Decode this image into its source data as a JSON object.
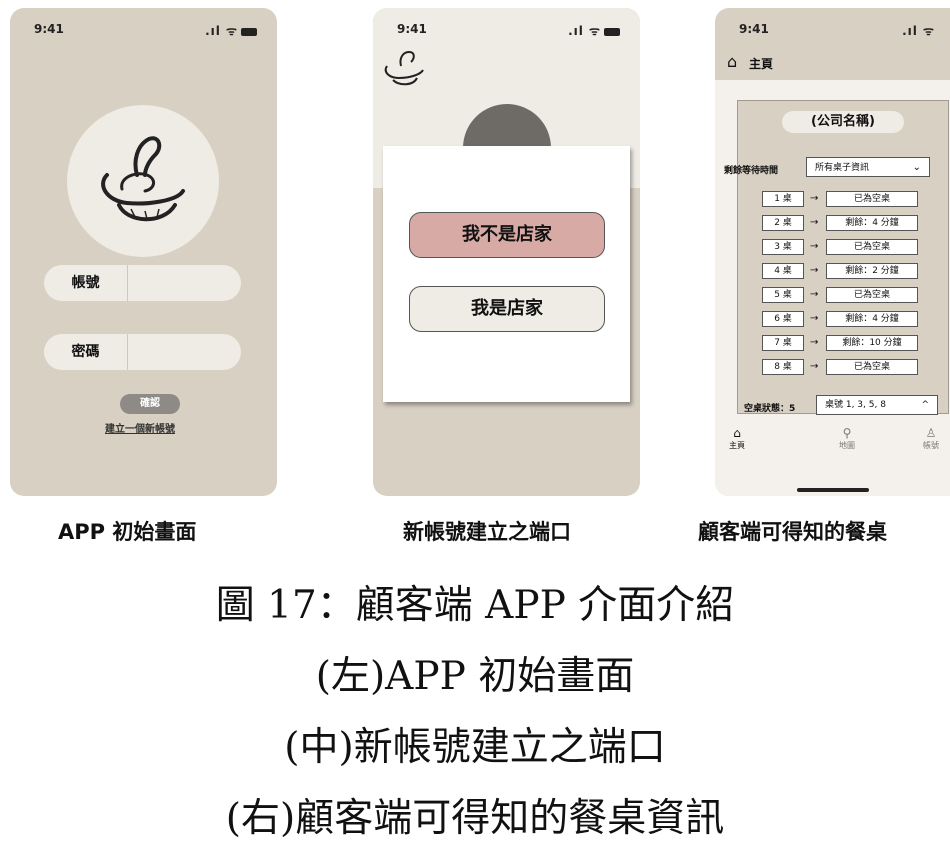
{
  "left_phone": {
    "status_time": "9:41",
    "status_signal": ".ıl ᯤ",
    "fields": [
      {
        "label": "帳號",
        "value": ""
      },
      {
        "label": "密碼",
        "value": ""
      }
    ],
    "confirm_button": "確認",
    "create_account_link": "建立一個新帳號"
  },
  "middle_phone": {
    "status_time": "9:41",
    "status_signal": ".ıl ᯤ",
    "buttons": [
      {
        "label": "我不是店家",
        "color": "#d8aaa6"
      },
      {
        "label": "我是店家",
        "color": "#efebe5"
      }
    ]
  },
  "right_phone": {
    "status_time": "9:41",
    "status_signal": ".ıl ᯤ",
    "header_icon": "home-icon",
    "header_title": "主頁",
    "company_name": "(公司名稱)",
    "wait_label": "剩餘等待時間",
    "select_value": "所有桌子資訊",
    "tables": [
      {
        "table": "1 桌",
        "status": "已為空桌"
      },
      {
        "table": "2 桌",
        "status": "剩餘：4 分鐘"
      },
      {
        "table": "3 桌",
        "status": "已為空桌"
      },
      {
        "table": "4 桌",
        "status": "剩餘：2 分鐘"
      },
      {
        "table": "5 桌",
        "status": "已為空桌"
      },
      {
        "table": "6 桌",
        "status": "剩餘：4 分鐘"
      },
      {
        "table": "7 桌",
        "status": "剩餘：10 分鐘"
      },
      {
        "table": "8 桌",
        "status": "已為空桌"
      }
    ],
    "empty_status_label": "空桌狀態：5",
    "empty_tables": "桌號 1, 3, 5, 8",
    "tabs": [
      {
        "icon": "home-icon",
        "label": "主頁"
      },
      {
        "icon": "map-icon",
        "label": "地圖"
      },
      {
        "icon": "account-icon",
        "label": "帳號"
      }
    ]
  },
  "captions": {
    "left": "APP 初始畫面",
    "middle": "新帳號建立之端口",
    "right": "顧客端可得知的餐桌"
  },
  "figure": {
    "title": "圖 17：顧客端 APP 介面介紹",
    "line1": "(左)APP 初始畫面",
    "line2": "(中)新帳號建立之端口",
    "line3": "(右)顧客端可得知的餐桌資訊"
  }
}
